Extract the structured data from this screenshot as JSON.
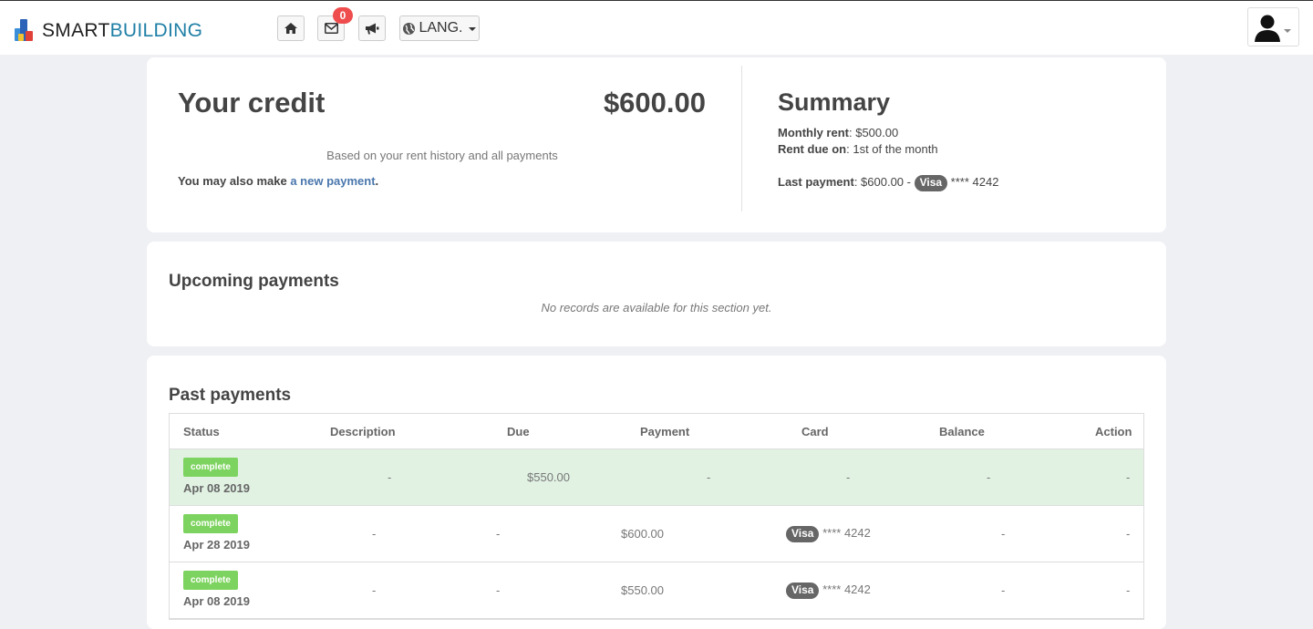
{
  "header": {
    "logo_part1": "SMART",
    "logo_part2": "BUILDING",
    "mail_count": "0",
    "lang_label": "LANG."
  },
  "credit": {
    "title": "Your credit",
    "amount": "$600.00",
    "note": "Based on your rent history and all payments",
    "pay_prefix": "You may also make ",
    "pay_link": "a new payment",
    "pay_suffix": "."
  },
  "summary": {
    "title": "Summary",
    "monthly_rent_label": "Monthly rent",
    "monthly_rent_value": ": $500.00",
    "rent_due_label": "Rent due on",
    "rent_due_value": ": 1st of the month",
    "last_payment_label": "Last payment",
    "last_payment_value": ": $600.00 - ",
    "last_payment_card_brand": "Visa",
    "last_payment_card_number": " **** 4242"
  },
  "upcoming": {
    "title": "Upcoming payments",
    "empty_text": "No records are available for this section yet."
  },
  "past": {
    "title": "Past payments",
    "columns": [
      "Status",
      "Description",
      "Due",
      "Payment",
      "Card",
      "Balance",
      "Action"
    ],
    "rows": [
      {
        "status": "complete",
        "date": "Apr 08 2019",
        "description": "-",
        "due": "$550.00",
        "payment": "-",
        "card": "-",
        "balance": "-",
        "action": "-"
      },
      {
        "status": "complete",
        "date": "Apr 28 2019",
        "description": "-",
        "due": "-",
        "payment": "$600.00",
        "card_brand": "Visa",
        "card_number": "**** 4242",
        "balance": "-",
        "action": "-"
      },
      {
        "status": "complete",
        "date": "Apr 08 2019",
        "description": "-",
        "due": "-",
        "payment": "$550.00",
        "card_brand": "Visa",
        "card_number": "**** 4242",
        "balance": "-",
        "action": "-"
      }
    ]
  },
  "colors": {
    "brand_blue": "#1f7fa6",
    "link": "#4a77ad",
    "complete_green": "#7dd35f",
    "highlight_row": "#e1f2e3",
    "badge_red": "#ef4d4d"
  }
}
